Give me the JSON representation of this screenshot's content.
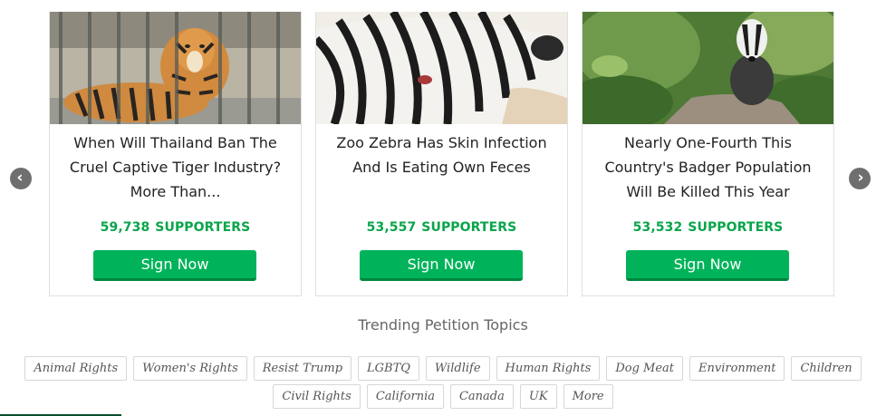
{
  "carousel": {
    "cards": [
      {
        "image": "caged-tiger-photo",
        "title_lines": [
          "When Will Thailand Ban The",
          "Cruel Captive Tiger Industry?",
          "More Than..."
        ],
        "count": "59,738",
        "supporters_label": "SUPPORTERS",
        "button_label": "Sign Now"
      },
      {
        "image": "zebra-photo",
        "title_lines": [
          "Zoo Zebra Has Skin Infection",
          "And Is Eating Own Feces"
        ],
        "count": "53,557",
        "supporters_label": "SUPPORTERS",
        "button_label": "Sign Now"
      },
      {
        "image": "badger-photo",
        "title_lines": [
          "Nearly One-Fourth This",
          "Country's Badger Population",
          "Will Be Killed This Year"
        ],
        "count": "53,532",
        "supporters_label": "SUPPORTERS",
        "button_label": "Sign Now"
      }
    ],
    "prev_icon": "chevron-left-icon",
    "next_icon": "chevron-right-icon"
  },
  "trending": {
    "heading": "Trending Petition Topics",
    "rows": [
      [
        "Animal Rights",
        "Women's Rights",
        "Resist Trump",
        "LGBTQ",
        "Wildlife",
        "Human Rights",
        "Dog Meat",
        "Environment",
        "Children"
      ],
      [
        "Civil Rights",
        "California",
        "Canada",
        "UK",
        "More"
      ]
    ]
  },
  "colors": {
    "accent_green": "#00b35a",
    "supporters_green": "#0aa44b",
    "arrow_gray": "#6f6f6f"
  }
}
